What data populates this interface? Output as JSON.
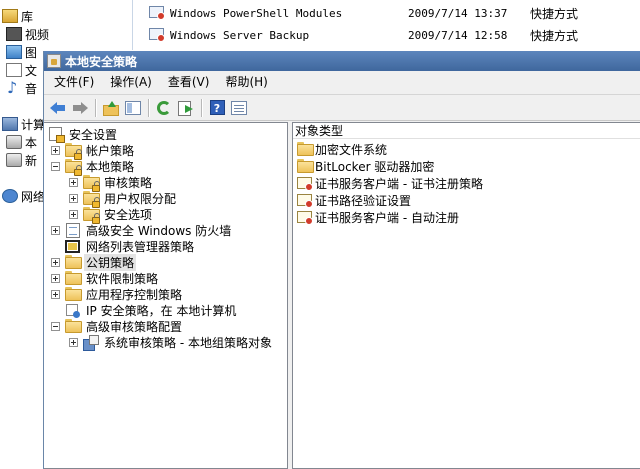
{
  "background": {
    "nav_items": [
      "库",
      "视频",
      "图",
      "文",
      "音",
      "计算",
      "本",
      "新",
      "网络"
    ],
    "files": [
      {
        "name": "Windows PowerShell Modules",
        "date": "2009/7/14 13:37",
        "type": "快捷方式"
      },
      {
        "name": "Windows Server Backup",
        "date": "2009/7/14 12:58",
        "type": "快捷方式"
      }
    ]
  },
  "window": {
    "title": "本地安全策略",
    "menu": [
      "文件(F)",
      "操作(A)",
      "查看(V)",
      "帮助(H)"
    ],
    "toolbar_icons": [
      "back-icon",
      "forward-icon",
      "up-folder-icon",
      "show-hide-tree-icon",
      "refresh-icon",
      "export-list-icon",
      "help-icon",
      "properties-icon"
    ]
  },
  "tree": {
    "root": "安全设置",
    "items": [
      {
        "label": "帐户策略",
        "level": 1,
        "expander": "plus",
        "icon": "folder-lock-icon"
      },
      {
        "label": "本地策略",
        "level": 1,
        "expander": "minus",
        "icon": "folder-lock-icon"
      },
      {
        "label": "审核策略",
        "level": 2,
        "expander": "plus",
        "icon": "folder-lock-icon"
      },
      {
        "label": "用户权限分配",
        "level": 2,
        "expander": "plus",
        "icon": "folder-lock-icon"
      },
      {
        "label": "安全选项",
        "level": 2,
        "expander": "plus",
        "icon": "folder-lock-icon"
      },
      {
        "label": "高级安全 Windows 防火墙",
        "level": 1,
        "expander": "plus",
        "icon": "firewall-doc-icon"
      },
      {
        "label": "网络列表管理器策略",
        "level": 1,
        "expander": "none",
        "icon": "network-list-icon"
      },
      {
        "label": "公钥策略",
        "level": 1,
        "expander": "plus",
        "icon": "folder-icon",
        "selected": true
      },
      {
        "label": "软件限制策略",
        "level": 1,
        "expander": "plus",
        "icon": "folder-icon"
      },
      {
        "label": "应用程序控制策略",
        "level": 1,
        "expander": "plus",
        "icon": "folder-icon"
      },
      {
        "label": "IP 安全策略，在 本地计算机",
        "level": 1,
        "expander": "none",
        "icon": "ipsec-icon"
      },
      {
        "label": "高级审核策略配置",
        "level": 1,
        "expander": "minus",
        "icon": "folder-icon"
      },
      {
        "label": "系统审核策略 - 本地组策略对象",
        "level": 2,
        "expander": "plus",
        "icon": "audit-policy-icon"
      }
    ]
  },
  "list": {
    "header": "对象类型",
    "items": [
      {
        "label": "加密文件系统",
        "icon": "folder-icon"
      },
      {
        "label": "BitLocker 驱动器加密",
        "icon": "folder-icon"
      },
      {
        "label": "证书服务客户端 - 证书注册策略",
        "icon": "certificate-icon"
      },
      {
        "label": "证书路径验证设置",
        "icon": "certificate-icon"
      },
      {
        "label": "证书服务客户端 - 自动注册",
        "icon": "certificate-icon"
      }
    ]
  }
}
